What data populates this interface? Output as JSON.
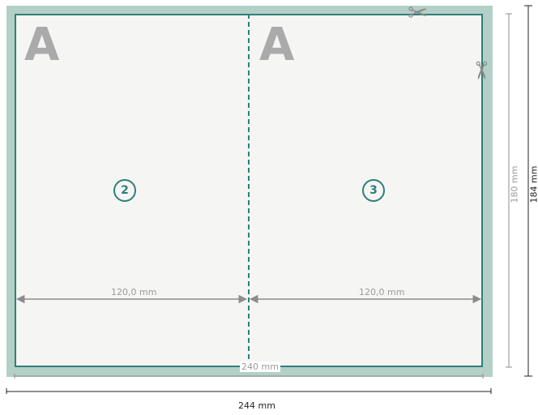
{
  "panels": [
    {
      "letter": "A",
      "page_number": "2",
      "width_label": "120,0 mm"
    },
    {
      "letter": "A",
      "page_number": "3",
      "width_label": "120,0 mm"
    }
  ],
  "dimensions": {
    "trim_width": "240 mm",
    "bleed_width": "244 mm",
    "trim_height": "180 mm",
    "bleed_height": "184 mm"
  },
  "icons": {
    "cut_top": "scissors-icon",
    "cut_right": "scissors-icon"
  },
  "colors": {
    "bleed": "#b3d0c6",
    "paper": "#f5f5f4",
    "accent": "#2f7f7a",
    "dimension_gray": "#9b9b9b",
    "dimension_dark": "#222222"
  }
}
